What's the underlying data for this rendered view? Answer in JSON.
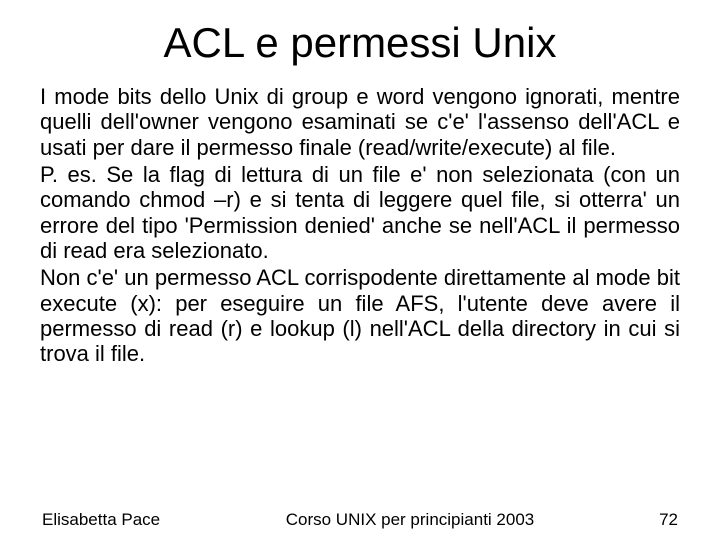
{
  "title": "ACL e permessi Unix",
  "body": {
    "p1": "I mode bits dello Unix di group e word vengono ignorati, mentre quelli dell'owner vengono esaminati se c'e' l'assenso dell'ACL e usati per dare il permesso finale (read/write/execute) al file.",
    "p2": "P. es. Se la flag di lettura di un file e' non selezionata (con un comando chmod –r) e si tenta di leggere quel file, si otterra' un errore del tipo 'Permission denied' anche se nell'ACL il permesso di read era selezionato.",
    "p3": "Non c'e' un permesso ACL corrispodente direttamente al mode bit execute (x): per eseguire un file AFS, l'utente deve avere il permesso di read (r) e lookup (l) nell'ACL della directory in cui si trova il file."
  },
  "footer": {
    "author": "Elisabetta Pace",
    "course": "Corso UNIX per principianti 2003",
    "page": "72"
  }
}
